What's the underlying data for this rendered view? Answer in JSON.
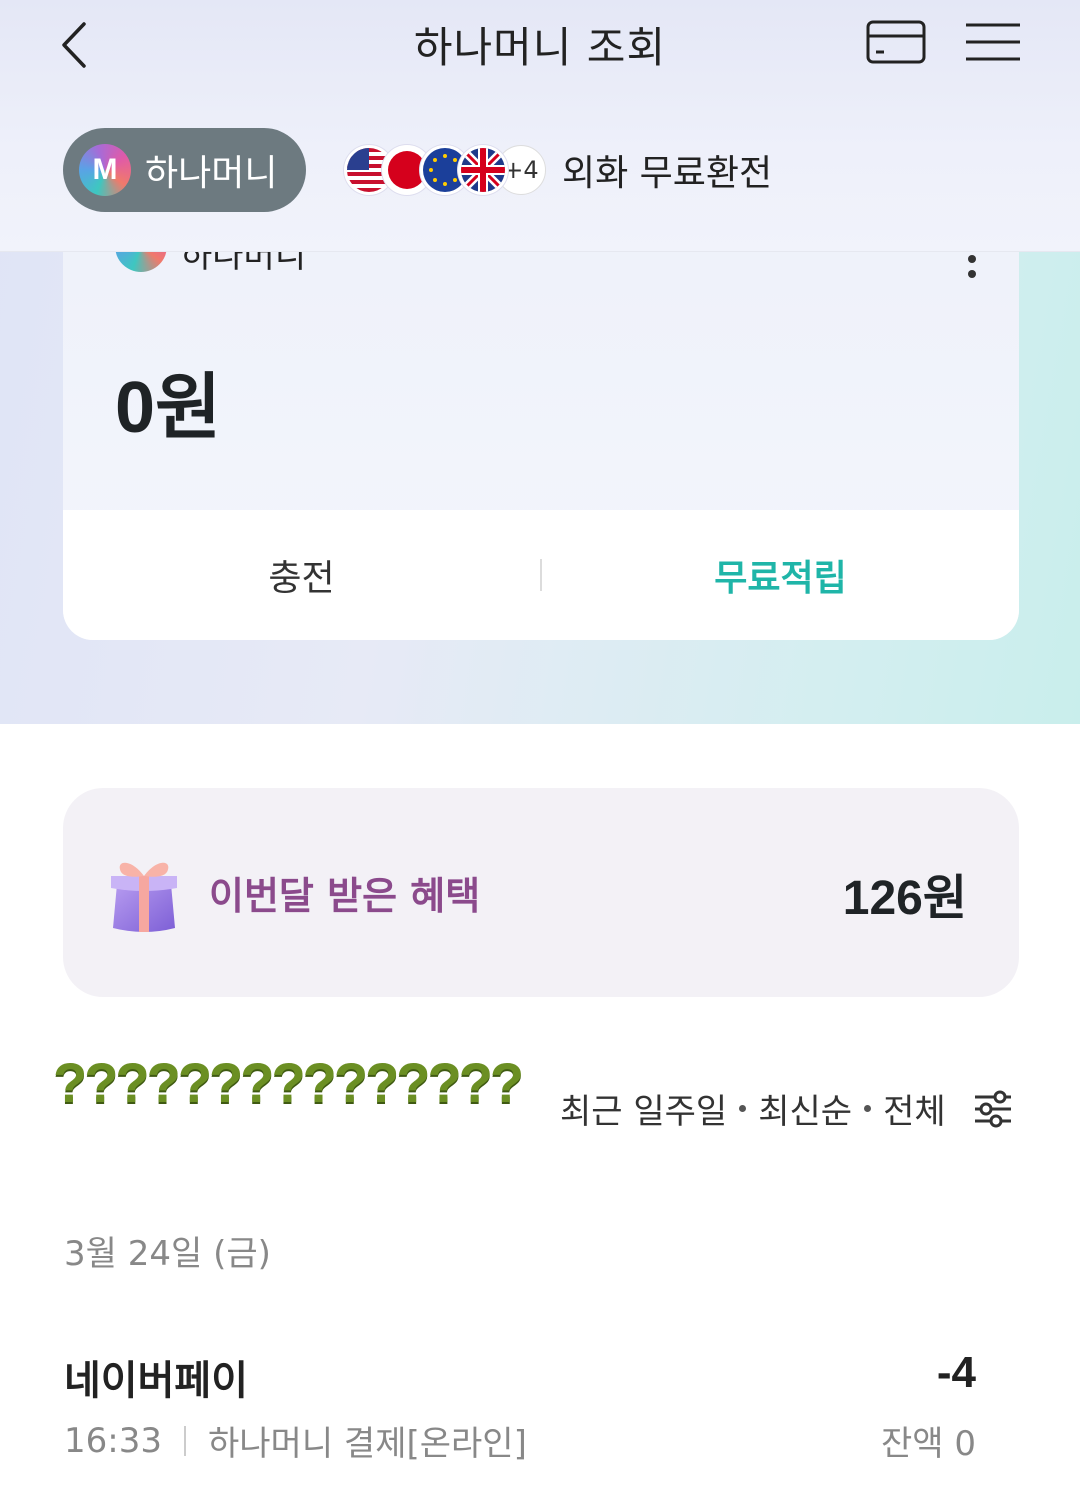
{
  "header": {
    "title": "하나머니 조회"
  },
  "wallet_pill": {
    "logo_letter": "M",
    "label": "하나머니"
  },
  "fx": {
    "flags": [
      "us-flag",
      "jp-flag",
      "eu-flag",
      "uk-flag"
    ],
    "more_count": "+4",
    "label": "외화 무료환전"
  },
  "card": {
    "name": "하나머니",
    "balance": "0원",
    "actions": {
      "charge": "충전",
      "free_earn": "무료적립"
    }
  },
  "benefit": {
    "label": "이번달 받은 혜택",
    "value": "126원"
  },
  "overlay_text": "???????????????",
  "filter": {
    "period": "최근 일주일",
    "sort": "최신순",
    "type": "전체"
  },
  "transactions": {
    "date": "3월 24일 (금)",
    "items": [
      {
        "merchant": "네이버페이",
        "amount": "-4",
        "time": "16:33",
        "description": "하나머니 결제[온라인]",
        "balance": "잔액 0"
      }
    ]
  },
  "colors": {
    "accent": "#1fb5a8",
    "benefit": "#8b4a8c",
    "pill": "#6d7a80"
  }
}
